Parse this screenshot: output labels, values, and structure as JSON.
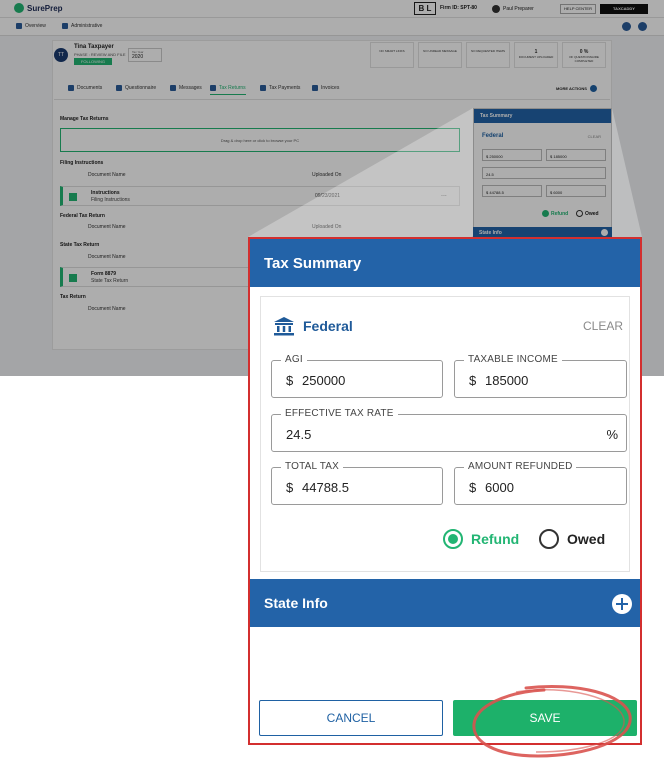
{
  "app": {
    "logo": "SurePrep",
    "firm_badge": "B L",
    "firm_id": "Firm ID: SPT-80",
    "user": "Paul Preparer",
    "help": "HELP CENTER",
    "taxcaddy": "TAXCADDY"
  },
  "nav": {
    "overview": "Overview",
    "administrative": "Administrative"
  },
  "client": {
    "initials": "TT",
    "name": "Tina Taxpayer",
    "phase": "PHASE : REVIEW AND FILE",
    "following": "FOLLOWING",
    "tax_year_label": "Tax Year",
    "tax_year": "2020"
  },
  "stats": [
    {
      "value": "",
      "label": "NO SMART LINKS"
    },
    {
      "value": "",
      "label": "NO UNREAD MESSAGE"
    },
    {
      "value": "",
      "label": "NO REQUESTED ITEMS"
    },
    {
      "value": "1",
      "label": "DOCUMENT UPLOADED"
    },
    {
      "value": "0 %",
      "label": "OF QUESTIONNAIRE COMPLETED"
    }
  ],
  "tabs": [
    "Documents",
    "Questionnaire",
    "Messages",
    "Tax Returns",
    "Tax Payments",
    "Invoices"
  ],
  "more_actions": "MORE ACTIONS",
  "manage": {
    "title": "Manage Tax Returns",
    "dropzone": "Drag & drop here or click to browse your PC",
    "filing_instructions": "Filing Instructions",
    "federal_return": "Federal Tax Return",
    "state_return": "State Tax Return",
    "tax_return": "Tax Return",
    "col_doc": "Document Name",
    "col_uploaded": "Uploaded On",
    "row1_title": "Instructions",
    "row1_sub": "Filing Instructions",
    "row1_date": "09/23/2021",
    "row2_title": "Form 8879",
    "row2_sub": "State Tax Return",
    "row_dots": "..."
  },
  "dialog": {
    "title": "Tax Summary",
    "federal": {
      "title": "Federal",
      "clear": "CLEAR",
      "agi_label": "AGI",
      "agi_prefix": "$",
      "agi_value": "250000",
      "taxable_label": "TAXABLE INCOME",
      "taxable_prefix": "$",
      "taxable_value": "185000",
      "rate_label": "EFFECTIVE TAX RATE",
      "rate_value": "24.5",
      "rate_suffix": "%",
      "total_label": "TOTAL TAX",
      "total_prefix": "$",
      "total_value": "44788.5",
      "refund_label": "AMOUNT REFUNDED",
      "refund_prefix": "$",
      "refund_value": "6000",
      "radio_refund": "Refund",
      "radio_owed": "Owed",
      "selected": "Refund"
    },
    "state_info": "State Info",
    "cancel": "CANCEL",
    "save": "SAVE"
  },
  "colors": {
    "header_blue": "#2363a8",
    "accent_green": "#1db16a",
    "annotation_red": "#d32f2f"
  }
}
